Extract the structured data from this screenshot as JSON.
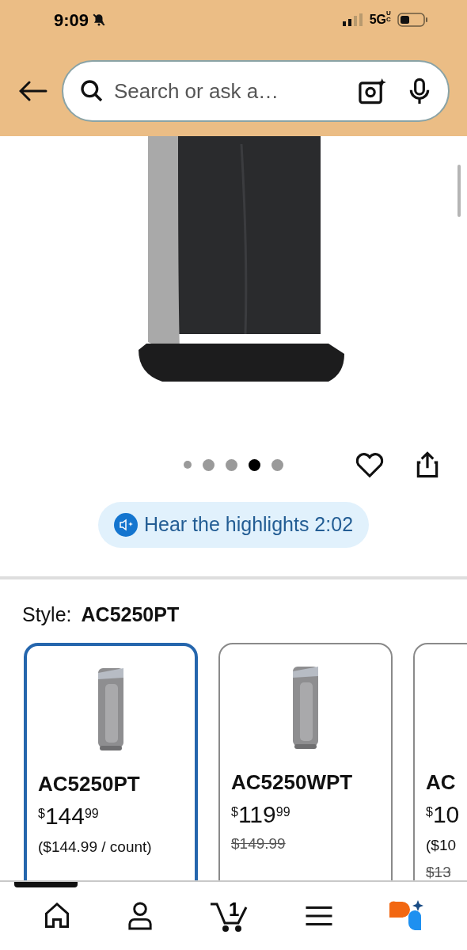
{
  "status_bar": {
    "time": "9:09",
    "network": "5G",
    "network_suffix": "UC"
  },
  "search": {
    "placeholder": "Search or ask a…"
  },
  "gallery": {
    "dots": [
      {
        "selected": false
      },
      {
        "selected": false
      },
      {
        "selected": false
      },
      {
        "selected": true
      },
      {
        "selected": false
      }
    ]
  },
  "highlights": {
    "label": "Hear the highlights 2:02"
  },
  "style": {
    "label": "Style:",
    "value": "AC5250PT"
  },
  "variants": [
    {
      "name": "AC5250PT",
      "currency": "$",
      "whole": "144",
      "cents": "99",
      "note": "($144.99 / count)",
      "selected": true,
      "image": true
    },
    {
      "name": "AC5250WPT",
      "currency": "$",
      "whole": "119",
      "cents": "99",
      "old_price": "$149.99",
      "selected": false,
      "image": true
    },
    {
      "name": "AC",
      "currency": "$",
      "whole": "10",
      "note": "($10",
      "old_price": "$13",
      "selected": false,
      "image": false
    }
  ],
  "bottom_nav": {
    "cart_count": "1"
  }
}
